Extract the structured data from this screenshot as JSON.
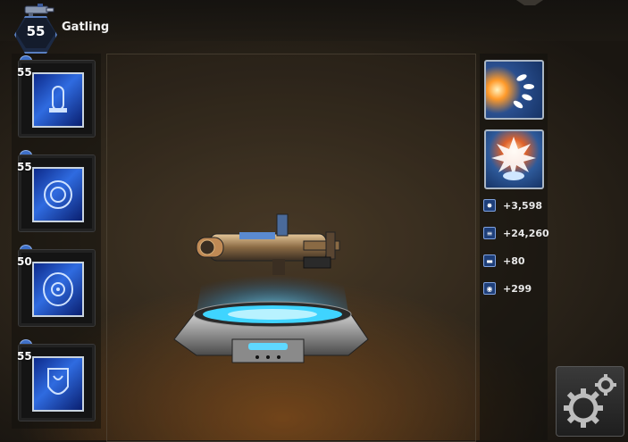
{
  "header": {
    "level": "55",
    "weapon_name": "Gatling"
  },
  "modules": [
    {
      "level": "55",
      "icon": "bullet-chip-icon"
    },
    {
      "level": "55",
      "icon": "ring-chip-icon"
    },
    {
      "level": "50",
      "icon": "target-chip-icon"
    },
    {
      "level": "55",
      "icon": "shield-chip-icon"
    }
  ],
  "abilities": [
    {
      "icon": "rapid-fire-icon"
    },
    {
      "icon": "explosion-icon"
    }
  ],
  "stats": [
    {
      "icon": "damage-burst-icon",
      "value": "+3,598"
    },
    {
      "icon": "magazine-icon",
      "value": "+24,260"
    },
    {
      "icon": "ammo-bar-icon",
      "value": "+80"
    },
    {
      "icon": "crosshair-icon",
      "value": "+299"
    }
  ],
  "colors": {
    "accent_blue": "#2f6be0",
    "frame_silver": "#c9d4e0",
    "hologram_cyan": "#5fd8ff"
  }
}
